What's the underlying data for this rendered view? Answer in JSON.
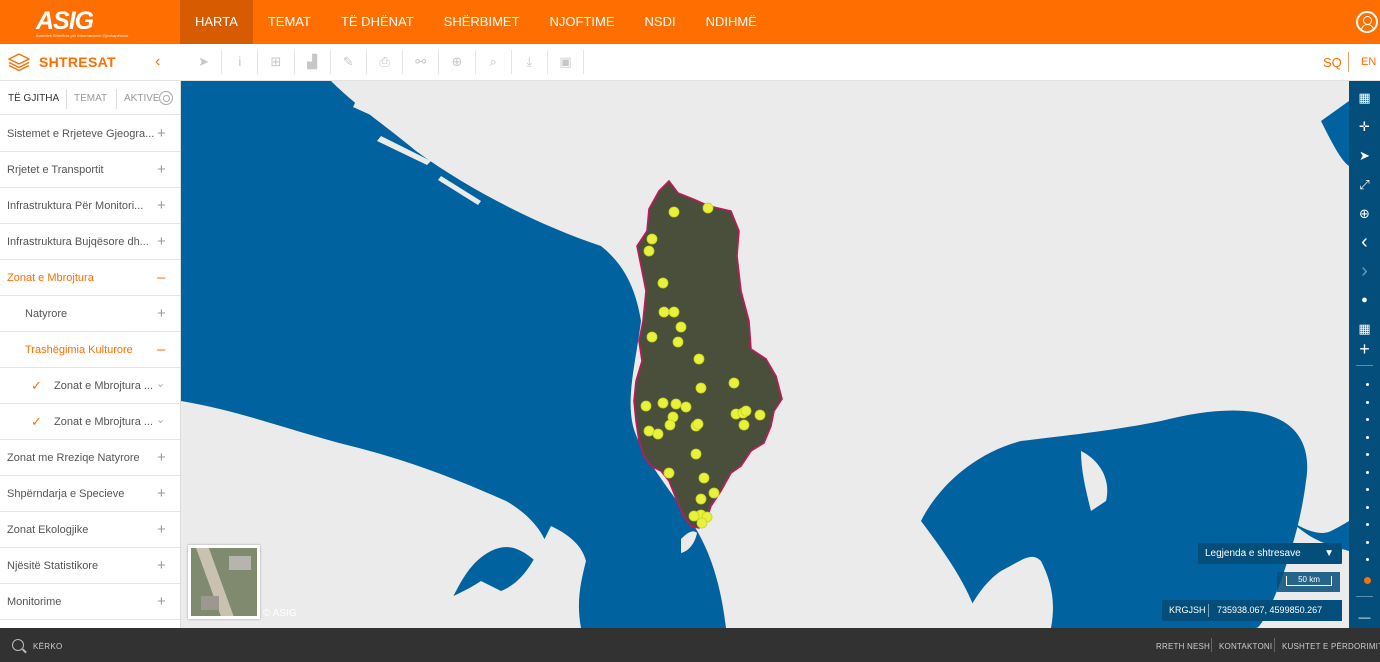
{
  "header": {
    "logo_text": "ASIG",
    "logo_subtitle": "Autoriteti Shtetëror për Informacionin Gjeohapësinor",
    "nav": [
      "HARTA",
      "TEMAT",
      "TË DHËNAT",
      "SHËRBIMET",
      "NJOFTIME",
      "NSDI",
      "NDIHMË"
    ],
    "active_nav": "HARTA"
  },
  "subbar": {
    "title": "SHTRESAT",
    "collapse_glyph": "‹",
    "tools": [
      {
        "name": "select-tool",
        "glyph": "➤"
      },
      {
        "name": "info-tool",
        "glyph": "i"
      },
      {
        "name": "add-layer-tool",
        "glyph": "⊞"
      },
      {
        "name": "profile-tool",
        "glyph": "▟"
      },
      {
        "name": "edit-tool",
        "glyph": "✎"
      },
      {
        "name": "print-tool",
        "glyph": "⎙"
      },
      {
        "name": "link-tool",
        "glyph": "⚯"
      },
      {
        "name": "add-tool",
        "glyph": "⊕"
      },
      {
        "name": "search-tool",
        "glyph": "⌕"
      },
      {
        "name": "download-tool",
        "glyph": "⤓"
      },
      {
        "name": "image-tool",
        "glyph": "▣"
      }
    ],
    "lang_sq": "SQ",
    "lang_en": "EN"
  },
  "sidebar": {
    "tabs": [
      "TË GJITHA",
      "TEMAT",
      "AKTIVE"
    ],
    "layers": [
      {
        "label": "Sistemet e Rrjeteve Gjeogra...",
        "toggle": "+",
        "indent": 0,
        "state": "normal"
      },
      {
        "label": "Rrjetet e Transportit",
        "toggle": "+",
        "indent": 0,
        "state": "normal"
      },
      {
        "label": "Infrastruktura Për Monitori...",
        "toggle": "+",
        "indent": 0,
        "state": "normal"
      },
      {
        "label": "Infrastruktura Bujqësore dh...",
        "toggle": "+",
        "indent": 0,
        "state": "normal"
      },
      {
        "label": "Zonat e Mbrojtura",
        "toggle": "–",
        "indent": 0,
        "state": "open"
      },
      {
        "label": "Natyrore",
        "toggle": "+",
        "indent": 1,
        "state": "normal"
      },
      {
        "label": "Trashëgimia Kulturore",
        "toggle": "–",
        "indent": 1,
        "state": "open"
      },
      {
        "label": "Zonat e Mbrojtura ...",
        "toggle": "⌄",
        "indent": 2,
        "state": "checked"
      },
      {
        "label": "Zonat e Mbrojtura ...",
        "toggle": "⌄",
        "indent": 2,
        "state": "checked"
      },
      {
        "label": "Zonat me Rreziqe Natyrore",
        "toggle": "+",
        "indent": 0,
        "state": "normal"
      },
      {
        "label": "Shpërndarja e Specieve",
        "toggle": "+",
        "indent": 0,
        "state": "normal"
      },
      {
        "label": "Zonat Ekologjike",
        "toggle": "+",
        "indent": 0,
        "state": "normal"
      },
      {
        "label": "Njësitë Statistikore",
        "toggle": "+",
        "indent": 0,
        "state": "normal"
      },
      {
        "label": "Monitorime",
        "toggle": "+",
        "indent": 0,
        "state": "normal"
      }
    ]
  },
  "map": {
    "copyright": "© ASIG",
    "legend_label": "Legjenda e shtresave",
    "scale_label": "50 km",
    "crs": "KRGJSH",
    "coordinates": "735938.067, 4599850.267",
    "colors": {
      "sea": "#0063a0",
      "land": "#ebebeb",
      "country": "#4a4f3c",
      "border": "#c2185b",
      "points": "#e8f23a",
      "panel": "#034e7a",
      "accent": "#ff6e00"
    }
  },
  "maptools": [
    {
      "name": "basemap-icon",
      "glyph": "▦"
    },
    {
      "name": "fullscreen-icon",
      "glyph": "✛"
    },
    {
      "name": "locate-icon",
      "glyph": "➤"
    },
    {
      "name": "expand-icon",
      "glyph": "⤢"
    },
    {
      "name": "zoom-extent-icon",
      "glyph": "⊕"
    },
    {
      "name": "back-icon",
      "glyph": "‹"
    },
    {
      "name": "forward-icon",
      "glyph": "›"
    },
    {
      "name": "globe-icon",
      "glyph": "●"
    },
    {
      "name": "grid-icon",
      "glyph": "▦"
    }
  ],
  "zoom": {
    "plus": "+",
    "minus": "—",
    "levels": 12,
    "current_level": 12
  },
  "footer": {
    "search_label": "KËRKO",
    "links": [
      "RRETH NESH",
      "KONTAKTONI",
      "KUSHTET E PËRDORIMIT"
    ]
  }
}
